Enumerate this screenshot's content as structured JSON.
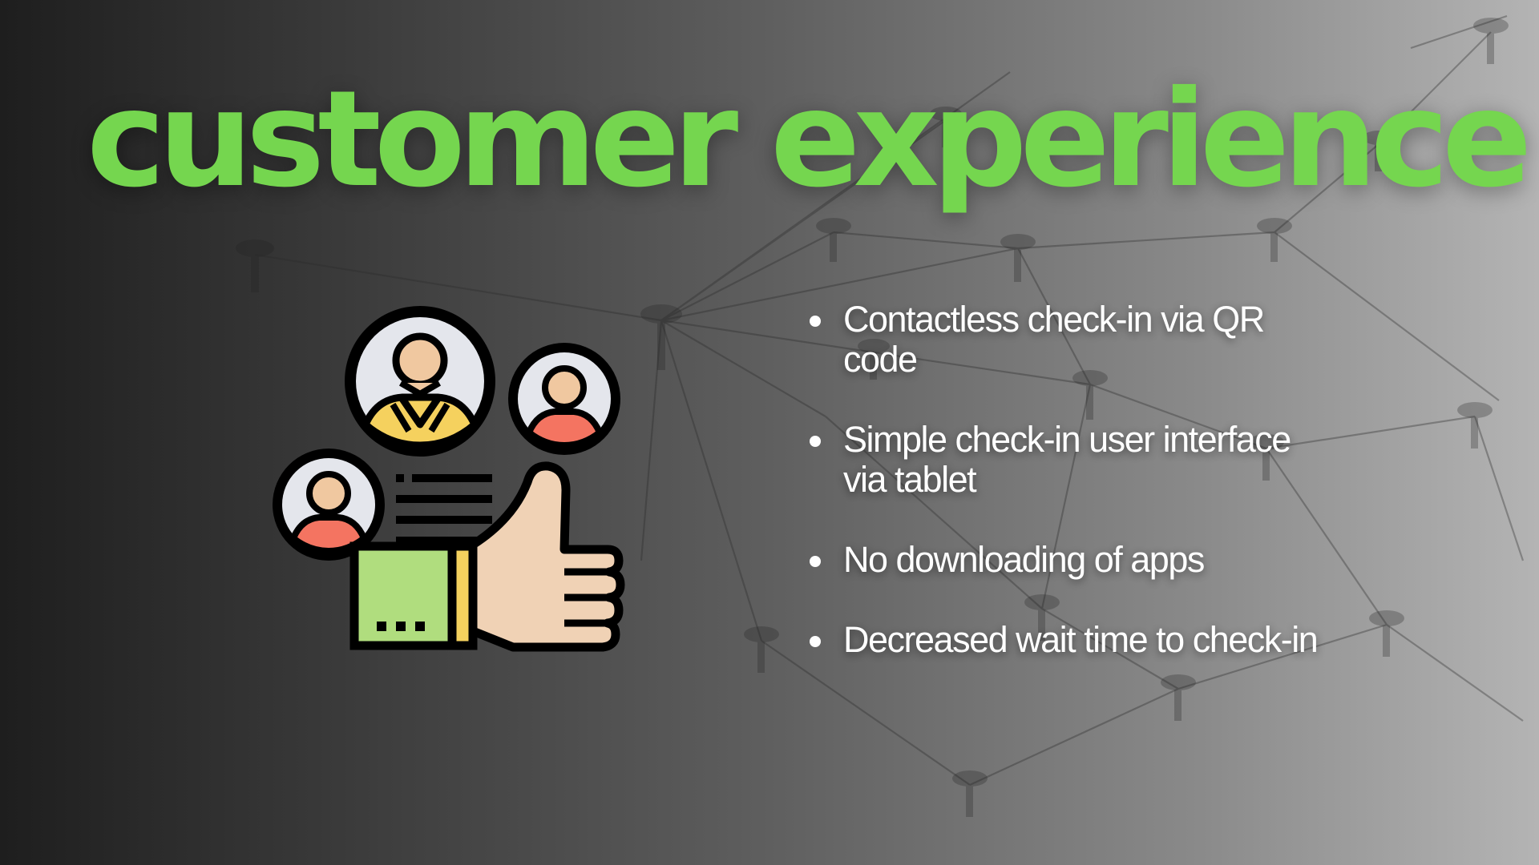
{
  "slide": {
    "title": "customer experience",
    "title_color": "#75d64f",
    "background": "dark-to-light grey gradient with faint pin-and-string network photo",
    "illustration": {
      "icon": "customer-satisfaction-thumbs-up-icon",
      "parts": [
        "person-avatar-icon",
        "person-avatar-icon",
        "person-avatar-icon",
        "text-lines-icon",
        "thumbs-up-icon"
      ]
    },
    "bullets": [
      {
        "text": "Contactless check-in via QR code"
      },
      {
        "text": "Simple check-in user interface via tablet"
      },
      {
        "text": "No downloading of apps"
      },
      {
        "text": "Decreased wait time to check-in"
      }
    ],
    "colors": {
      "accent_green": "#75d64f",
      "avatar_skin": "#f0c8a0",
      "avatar_red_shirt": "#f47461",
      "avatar_yellow_shirt": "#f5d15e",
      "sleeve_green": "#b0dd7e",
      "thumb_skin": "#f0d2b5",
      "outline": "#000000"
    }
  }
}
